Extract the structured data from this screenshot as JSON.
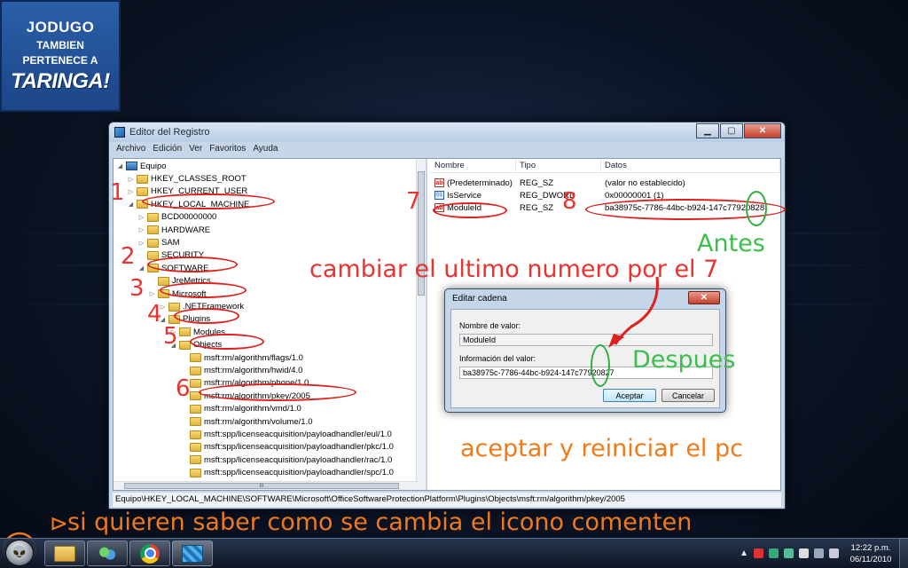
{
  "logo": {
    "line1": "JODUGO",
    "line2": "TAMBIEN",
    "line3": "PERTENECE A",
    "line4": "TARINGA!"
  },
  "window": {
    "title": "Editor del Registro",
    "controls": {
      "minimize": "▁",
      "maximize": "▢",
      "close": "✕"
    },
    "menu": [
      "Archivo",
      "Edición",
      "Ver",
      "Favoritos",
      "Ayuda"
    ],
    "tree": [
      {
        "label": "Equipo",
        "icon": "computer-icon",
        "expander": "◢"
      },
      {
        "label": "HKEY_CLASSES_ROOT",
        "icon": "folder-icon",
        "expander": "▷"
      },
      {
        "label": "HKEY_CURRENT_USER",
        "icon": "folder-icon",
        "expander": "▷"
      },
      {
        "label": "HKEY_LOCAL_MACHINE",
        "icon": "folder-icon",
        "expander": "◢"
      },
      {
        "label": "BCD00000000",
        "icon": "folder-icon",
        "expander": "▷"
      },
      {
        "label": "HARDWARE",
        "icon": "folder-icon",
        "expander": "▷"
      },
      {
        "label": "SAM",
        "icon": "folder-icon",
        "expander": "▷"
      },
      {
        "label": "SECURITY",
        "icon": "folder-icon",
        "expander": ""
      },
      {
        "label": "SOFTWARE",
        "icon": "folder-icon",
        "expander": "◢"
      },
      {
        "label": "JreMetrics",
        "icon": "folder-icon",
        "expander": ""
      },
      {
        "label": "Microsoft",
        "icon": "folder-icon",
        "expander": "▷"
      },
      {
        "label": ".NETFramework",
        "icon": "folder-icon",
        "expander": "▷"
      },
      {
        "label": "Plugins",
        "icon": "folder-icon",
        "expander": "◢"
      },
      {
        "label": "Modules",
        "icon": "folder-icon",
        "expander": "▷"
      },
      {
        "label": "Objects",
        "icon": "folder-icon",
        "expander": "◢"
      },
      {
        "label": "msft:rm/algorithm/flags/1.0",
        "icon": "folder-icon",
        "expander": ""
      },
      {
        "label": "msft:rm/algorithm/hwid/4.0",
        "icon": "folder-icon",
        "expander": ""
      },
      {
        "label": "msft:rm/algorithm/phone/1.0",
        "icon": "folder-icon",
        "expander": ""
      },
      {
        "label": "msft:rm/algorithm/pkey/2005",
        "icon": "folder-icon",
        "expander": ""
      },
      {
        "label": "msft:rm/algorithm/vmd/1.0",
        "icon": "folder-icon",
        "expander": ""
      },
      {
        "label": "msft:rm/algorithm/volume/1.0",
        "icon": "folder-icon",
        "expander": ""
      },
      {
        "label": "msft:spp/licenseacquisition/payloadhandler/eul/1.0",
        "icon": "folder-icon",
        "expander": ""
      },
      {
        "label": "msft:spp/licenseacquisition/payloadhandler/pkc/1.0",
        "icon": "folder-icon",
        "expander": ""
      },
      {
        "label": "msft:spp/licenseacquisition/payloadhandler/rac/1.0",
        "icon": "folder-icon",
        "expander": ""
      },
      {
        "label": "msft:spp/licenseacquisition/payloadhandler/spc/1.0",
        "icon": "folder-icon",
        "expander": ""
      }
    ],
    "hscroll_label": "III",
    "list": {
      "headers": [
        "Nombre",
        "Tipo",
        "Datos"
      ],
      "rows": [
        {
          "name": "(Predeterminado)",
          "type": "REG_SZ",
          "data": "(valor no establecido)",
          "icon": "ab"
        },
        {
          "name": "IsService",
          "type": "REG_DWORD",
          "data": "0x00000001 (1)",
          "icon": "bin"
        },
        {
          "name": "ModuleId",
          "type": "REG_SZ",
          "data": "ba38975c-7786-44bc-b924-147c77920828",
          "icon": "ab"
        }
      ]
    },
    "status": "Equipo\\HKEY_LOCAL_MACHINE\\SOFTWARE\\Microsoft\\OfficeSoftwareProtectionPlatform\\Plugins\\Objects\\msft:rm/algorithm/pkey/2005"
  },
  "dialog": {
    "title": "Editar cadena",
    "close": "✕",
    "name_label": "Nombre de valor:",
    "name_value": "ModuleId",
    "data_label": "Información del valor:",
    "data_value": "ba38975c-7786-44bc-b924-147c77920827",
    "ok": "Aceptar",
    "cancel": "Cancelar"
  },
  "annotations": {
    "numbers": [
      "1",
      "2",
      "3",
      "4",
      "5",
      "6",
      "7",
      "8"
    ],
    "instruction": "cambiar el ultimo numero por el 7",
    "before": "Antes",
    "after": "Despues",
    "accept": "aceptar y reiniciar el pc",
    "footer_arrow": "⊳",
    "footer": "si quieren saber como se cambia el icono comenten",
    "colors": {
      "red": "#e8332f",
      "green": "#3cbf4a",
      "orange": "#f07a1a"
    }
  },
  "taskbar": {
    "start": "👽",
    "clock_time": "12:22 p.m.",
    "clock_date": "06/11/2010",
    "tray_arrow": "▲"
  }
}
